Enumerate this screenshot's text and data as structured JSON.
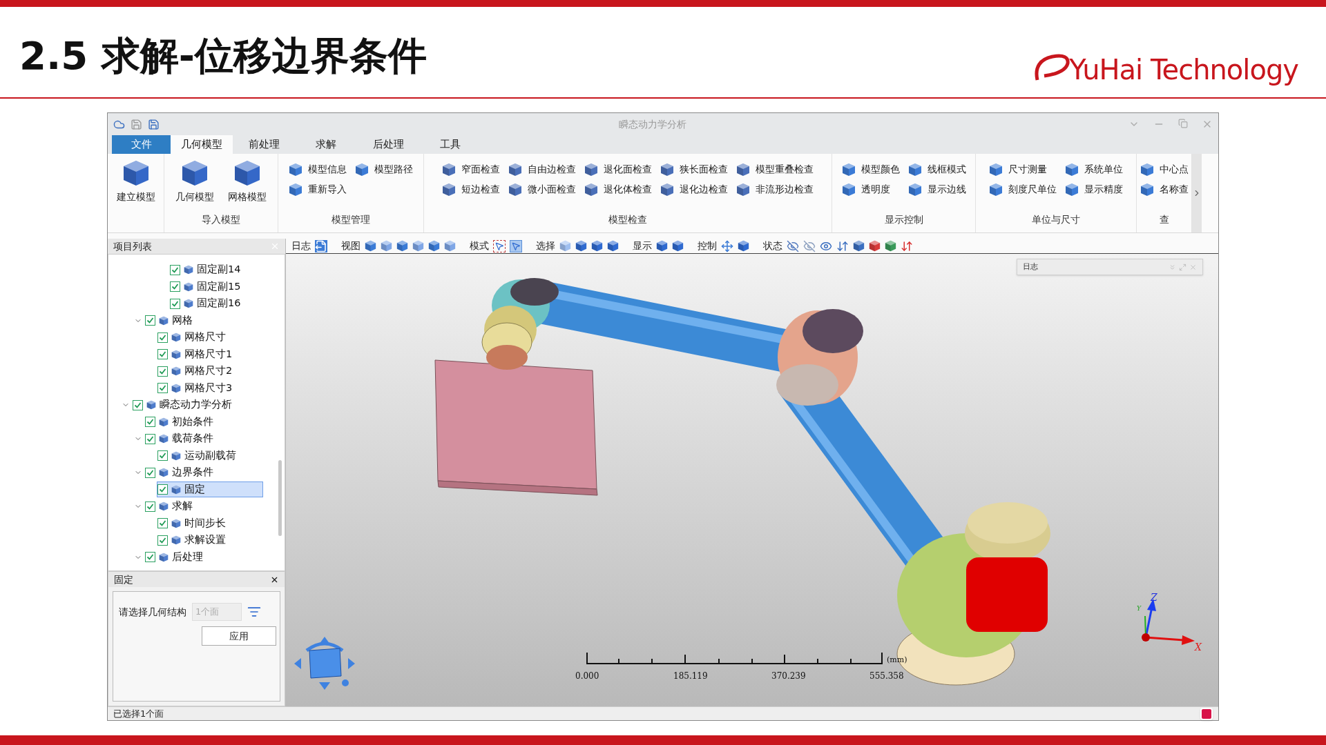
{
  "slide": {
    "title": "2.5 求解-位移边界条件",
    "logo": "YuHai Technology"
  },
  "window": {
    "title": "瞬态动力学分析"
  },
  "ribbon_tabs": [
    {
      "label": "文件",
      "kind": "file",
      "selected": false
    },
    {
      "label": "几何模型",
      "kind": "tab",
      "selected": true
    },
    {
      "label": "前处理",
      "kind": "tab",
      "selected": false
    },
    {
      "label": "求解",
      "kind": "tab",
      "selected": false
    },
    {
      "label": "后处理",
      "kind": "tab",
      "selected": false
    },
    {
      "label": "工具",
      "kind": "tab",
      "selected": false
    }
  ],
  "ribbon_groups": [
    {
      "large_buttons": [
        "建立模型"
      ]
    },
    {
      "label": "导入模型",
      "large_buttons": [
        "几何模型",
        "网格模型"
      ]
    },
    {
      "label": "模型管理",
      "small_buttons": [
        "模型信息",
        "重新导入",
        "模型路径"
      ]
    },
    {
      "label": "模型检查",
      "small_buttons": [
        "窄面检查",
        "短边检查",
        "自由边检查",
        "微小面检查",
        "退化面检查",
        "退化体检查",
        "狭长面检查",
        "退化边检查",
        "模型重叠检查",
        "非流形边检查"
      ]
    },
    {
      "label": "显示控制",
      "small_buttons": [
        "模型颜色",
        "透明度",
        "线框模式",
        "显示边线"
      ]
    },
    {
      "label": "单位与尺寸",
      "small_buttons": [
        "尺寸测量",
        "刻度尺单位",
        "系统单位",
        "显示精度"
      ]
    },
    {
      "label": "查",
      "small_buttons": [
        "中心点",
        "名称查"
      ]
    }
  ],
  "toolbar": [
    {
      "label": "日志"
    },
    {
      "label": "视图"
    },
    {
      "label": "模式",
      "modes": [
        {
          "selected": false
        },
        {
          "selected": true
        }
      ]
    },
    {
      "label": "选择"
    },
    {
      "label": "显示"
    },
    {
      "label": "控制"
    },
    {
      "label": "状态"
    }
  ],
  "project_panel": {
    "title": "项目列表",
    "tree": [
      {
        "children": [
          {
            "children": [
              {
                "children": [
                  {
                    "label": "固定副14",
                    "checked": true,
                    "selected": false
                  },
                  {
                    "label": "固定副15",
                    "checked": true,
                    "selected": false
                  },
                  {
                    "label": "固定副16",
                    "checked": true,
                    "selected": false
                  }
                ]
              }
            ]
          },
          {
            "label": "网格",
            "checked": true,
            "selected": false,
            "expanded": true,
            "children": [
              {
                "label": "网格尺寸",
                "checked": true,
                "selected": false
              },
              {
                "label": "网格尺寸1",
                "checked": true,
                "selected": false
              },
              {
                "label": "网格尺寸2",
                "checked": true,
                "selected": false
              },
              {
                "label": "网格尺寸3",
                "checked": true,
                "selected": false
              }
            ]
          }
        ]
      },
      {
        "label": "瞬态动力学分析",
        "checked": true,
        "selected": false,
        "expanded": true,
        "children": [
          {
            "label": "初始条件",
            "checked": true,
            "selected": false
          },
          {
            "label": "载荷条件",
            "checked": true,
            "selected": false,
            "expanded": true,
            "children": [
              {
                "label": "运动副载荷",
                "checked": true,
                "selected": false
              }
            ]
          },
          {
            "label": "边界条件",
            "checked": true,
            "selected": false,
            "expanded": true,
            "children": [
              {
                "label": "固定",
                "checked": true,
                "selected": true
              }
            ]
          },
          {
            "label": "求解",
            "checked": true,
            "selected": false,
            "expanded": true,
            "children": [
              {
                "label": "时间步长",
                "checked": true,
                "selected": false
              },
              {
                "label": "求解设置",
                "checked": true,
                "selected": false
              }
            ]
          },
          {
            "label": "后处理",
            "checked": true,
            "selected": false,
            "expanded": true
          }
        ]
      }
    ]
  },
  "properties_panel": {
    "title": "固定",
    "field_label": "请选择几何结构",
    "field_value": "1个面",
    "field_disabled": true,
    "apply_button": "应用"
  },
  "viewport": {
    "log_window_title": "日志",
    "scale_labels": [
      "0.000",
      "185.119",
      "370.239",
      "555.358"
    ],
    "scale_unit": "(mm)",
    "axis_labels": [
      "Z",
      "Y",
      "X"
    ]
  },
  "status_bar": "已选择1个面"
}
